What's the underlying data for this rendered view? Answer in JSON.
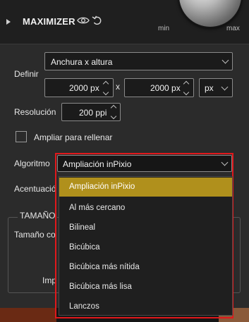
{
  "header": {
    "title": "MAXIMIZER",
    "knob_min": "min",
    "knob_max": "max"
  },
  "definir": {
    "label": "Definir",
    "mode_value": "Anchura x altura",
    "width_value": "2000 px",
    "separator": "x",
    "height_value": "2000 px",
    "unit_value": "px"
  },
  "resolucion": {
    "label": "Resolución",
    "value": "200 ppi"
  },
  "ampliar": {
    "label": "Ampliar para rellenar",
    "checked": false
  },
  "algoritmo": {
    "label": "Algoritmo",
    "value": "Ampliación inPixio",
    "options": [
      "Ampliación inPixio",
      "Al más cercano",
      "Bilineal",
      "Bicúbica",
      "Bicúbica más nítida",
      "Bicúbica más lisa",
      "Lanczos"
    ],
    "selected_index": 0
  },
  "acentuacion": {
    "label": "Acentuació"
  },
  "tamano": {
    "title": "TAMAÑO",
    "size_label": "Tamaño co",
    "imp_label": "Imp"
  },
  "colors": {
    "accent_selection": "#b0901c",
    "highlight_border": "#e0181b"
  }
}
